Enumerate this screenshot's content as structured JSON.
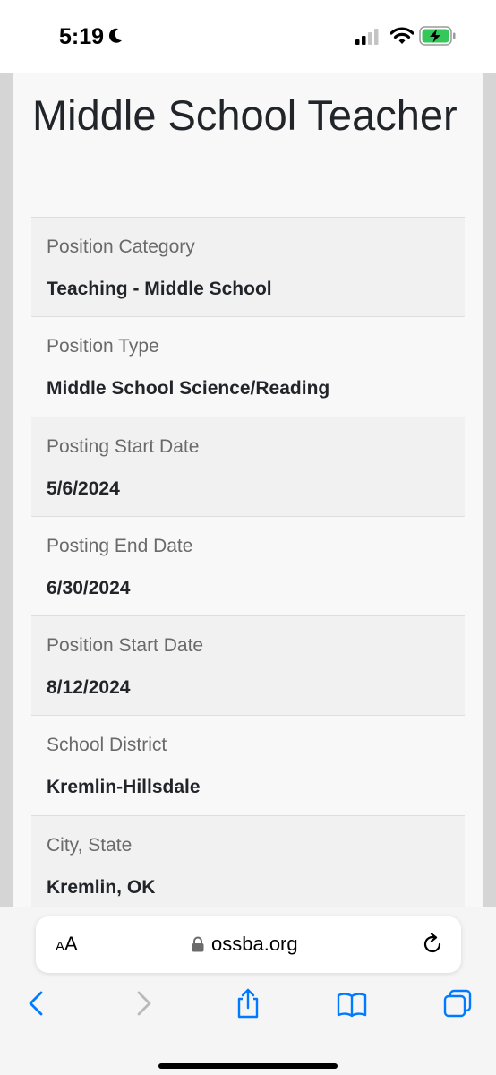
{
  "status_bar": {
    "time": "5:19",
    "icons": [
      "moon-icon",
      "cellular-signal-icon",
      "wifi-icon",
      "battery-charging-icon"
    ]
  },
  "page": {
    "title": "Middle School Teacher",
    "fields": [
      {
        "label": "Position Category",
        "value": "Teaching - Middle School"
      },
      {
        "label": "Position Type",
        "value": "Middle School Science/Reading"
      },
      {
        "label": "Posting Start Date",
        "value": "5/6/2024"
      },
      {
        "label": "Posting End Date",
        "value": "6/30/2024"
      },
      {
        "label": "Position Start Date",
        "value": "8/12/2024"
      },
      {
        "label": "School District",
        "value": "Kremlin-Hillsdale"
      },
      {
        "label": "City, State",
        "value": "Kremlin, OK"
      }
    ]
  },
  "browser": {
    "text_size_label_small": "A",
    "text_size_label_large": "A",
    "url": "ossba.org",
    "toolbar_icons": [
      "back-arrow-icon",
      "forward-arrow-icon",
      "share-icon",
      "bookmarks-icon",
      "tabs-icon"
    ],
    "accent_color": "#007aff",
    "battery_color": "#34c759"
  }
}
